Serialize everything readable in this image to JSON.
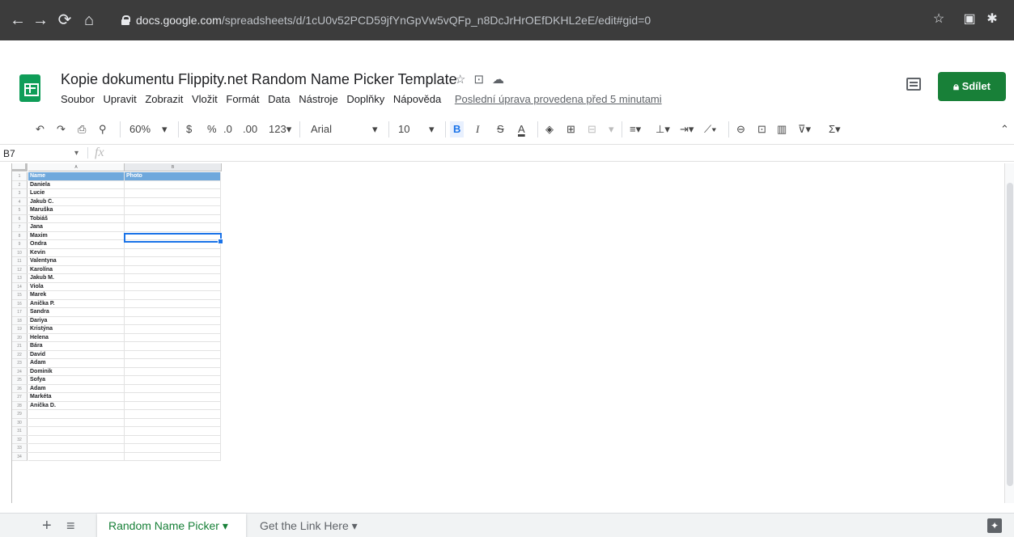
{
  "browser": {
    "url_host": "docs.google.com",
    "url_path": "/spreadsheets/d/1cU0v52PCD59jfYnGpVw5vQFp_n8DcJrHrOEfDKHL2eE/edit#gid=0"
  },
  "doc": {
    "title": "Kopie dokumentu Flippity.net Random Name Picker Template",
    "share_label": "Sdílet",
    "menus": [
      "Soubor",
      "Upravit",
      "Zobrazit",
      "Vložit",
      "Formát",
      "Data",
      "Nástroje",
      "Doplňky",
      "Nápověda"
    ],
    "last_edit": "Poslední úprava provedena před 5 minutami"
  },
  "toolbar": {
    "zoom": "60%",
    "currency": "$",
    "percent": "%",
    "dec_decrease": ".0",
    "dec_increase": ".00",
    "more_formats": "123▾",
    "font": "Arial",
    "font_size": "10",
    "bold": "B",
    "italic": "I",
    "strike": "S",
    "text_color": "A"
  },
  "formula_bar": {
    "cell_ref": "B7",
    "fx": "fx"
  },
  "columns": [
    "A",
    "B"
  ],
  "headers": [
    "Name",
    "Photo"
  ],
  "names": [
    "Daniela",
    "Lucie",
    "Jakub Č.",
    "Maruška",
    "Tobiáš",
    "Jana",
    "Maxim",
    "Ondra",
    "Kevin",
    "Valentyna",
    "Karolína",
    "Jakub M.",
    "Viola",
    "Marek",
    "Anička P.",
    "Sandra",
    "Dariya",
    "Kristýna",
    "Helena",
    "Bára",
    "David",
    "Adam",
    "Dominik",
    "Sofya",
    "Adam",
    "Markéta",
    "Anička D.",
    "",
    "",
    "",
    "",
    "",
    ""
  ],
  "sheets": {
    "active": "Random Name Picker",
    "inactive": "Get the Link Here"
  }
}
